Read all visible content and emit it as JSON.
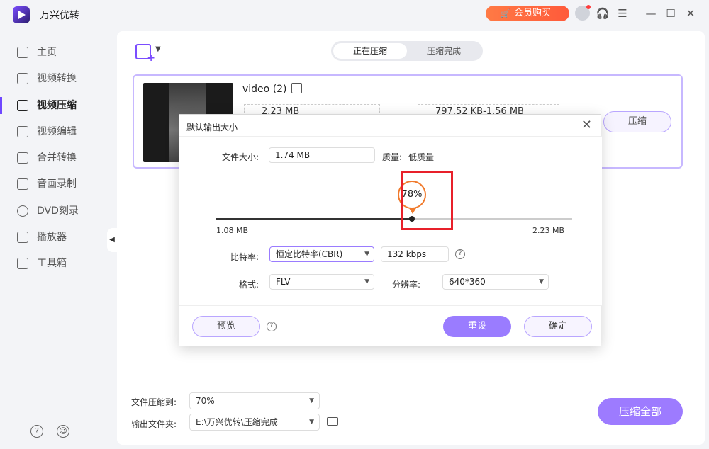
{
  "app": {
    "title": "万兴优转",
    "vip_label": "会员购买"
  },
  "sidebar": {
    "items": [
      {
        "label": "主页"
      },
      {
        "label": "视频转换"
      },
      {
        "label": "视频压缩"
      },
      {
        "label": "视频编辑"
      },
      {
        "label": "合并转换"
      },
      {
        "label": "音画录制"
      },
      {
        "label": "DVD刻录"
      },
      {
        "label": "播放器"
      },
      {
        "label": "工具箱"
      }
    ],
    "active_index": 2
  },
  "main": {
    "tabs": [
      {
        "label": "正在压缩"
      },
      {
        "label": "压缩完成"
      }
    ],
    "file": {
      "name": "video (2)",
      "original_size": "2.23 MB",
      "target_size": "797.52 KB-1.56 MB",
      "compress_label": "压缩"
    },
    "bottom": {
      "compress_to_label": "文件压缩到:",
      "compress_to_value": "70%",
      "output_label": "输出文件夹:",
      "output_value": "E:\\万兴优转\\压缩完成",
      "compress_all_label": "压缩全部"
    }
  },
  "dialog": {
    "title": "默认输出大小",
    "file_size_label": "文件大小:",
    "file_size_value": "1.74 MB",
    "quality_label": "质量:",
    "quality_value": "低质量",
    "slider": {
      "percent": 78,
      "percent_text": "78%",
      "min_label": "1.08 MB",
      "max_label": "2.23 MB"
    },
    "bitrate_label": "比特率:",
    "bitrate_mode": "恒定比特率(CBR)",
    "bitrate_value": "132 kbps",
    "format_label": "格式:",
    "format_value": "FLV",
    "resolution_label": "分辨率:",
    "resolution_value": "640*360",
    "preview_label": "预览",
    "reset_label": "重设",
    "ok_label": "确定"
  }
}
